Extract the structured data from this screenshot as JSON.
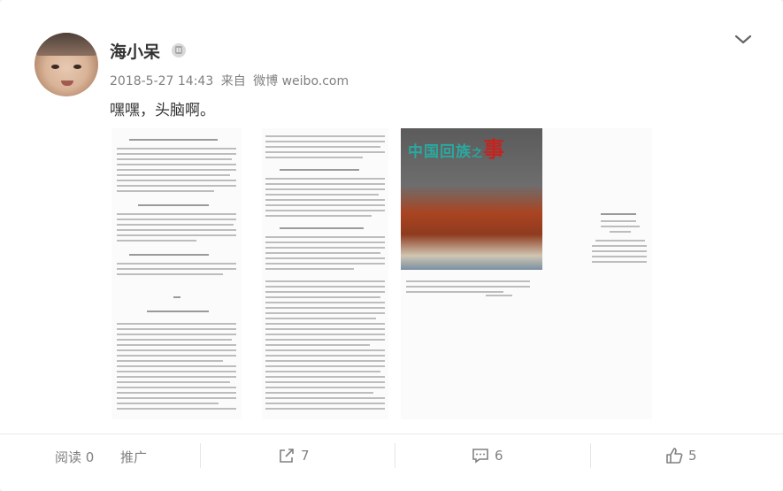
{
  "post": {
    "user_name": "海小呆",
    "timestamp": "2018-5-27 14:43",
    "source_prefix": "来自",
    "source_app": "微博 weibo.com",
    "text": "嘿嘿，头脑啊。"
  },
  "icons": {
    "vip": "vip-badge-icon",
    "more": "chevron-down-icon",
    "repost": "repost-icon",
    "comment": "comment-icon",
    "like": "like-icon"
  },
  "footer": {
    "read_label": "阅读",
    "read_count": "0",
    "promote_label": "推广",
    "repost_count": "7",
    "comment_count": "6",
    "like_count": "5"
  },
  "media": {
    "cover_title_part1": "中国回族",
    "cover_title_part2": "之",
    "cover_title_part3": "事"
  },
  "colors": {
    "text_primary": "#333333",
    "text_secondary": "#808080",
    "cover_title": "#2aa8a0",
    "cover_accent": "#c4241f"
  }
}
